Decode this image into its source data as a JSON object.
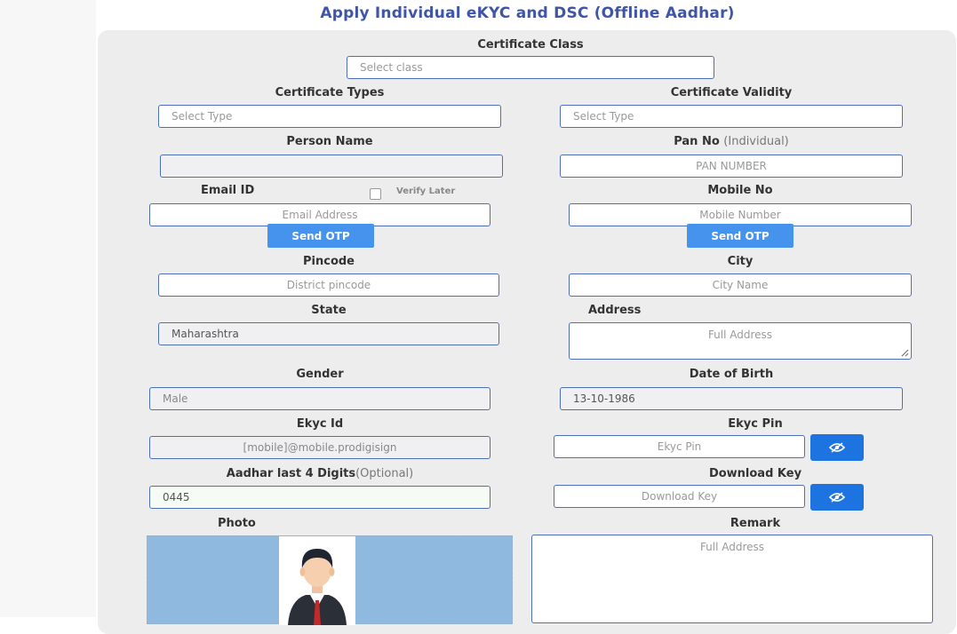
{
  "page": {
    "title": "Apply Individual eKYC and DSC (Offline Aadhar)"
  },
  "form": {
    "certificate_class": {
      "label": "Certificate Class",
      "placeholder": "Select class"
    },
    "certificate_types": {
      "label": "Certificate Types",
      "placeholder": "Select Type"
    },
    "certificate_validity": {
      "label": "Certificate Validity",
      "placeholder": "Select Type"
    },
    "person_name": {
      "label": "Person Name",
      "value": ""
    },
    "pan_no": {
      "label": "Pan No",
      "label_suffix": "(Individual)",
      "placeholder": "PAN NUMBER"
    },
    "email": {
      "label": "Email ID",
      "verify_later": "Verify Later",
      "placeholder": "Email Address",
      "send_otp": "Send OTP"
    },
    "mobile": {
      "label": "Mobile No",
      "placeholder": "Mobile Number",
      "send_otp": "Send OTP"
    },
    "pincode": {
      "label": "Pincode",
      "placeholder": "District pincode"
    },
    "city": {
      "label": "City",
      "placeholder": "City Name"
    },
    "state": {
      "label": "State",
      "value": "Maharashtra"
    },
    "address": {
      "label": "Address",
      "placeholder": "Full Address"
    },
    "gender": {
      "label": "Gender",
      "value": "Male"
    },
    "dob": {
      "label": "Date of Birth",
      "value": "13-10-1986"
    },
    "ekyc_id": {
      "label": "Ekyc Id",
      "value": "[mobile]@mobile.prodigisign"
    },
    "ekyc_pin": {
      "label": "Ekyc Pin",
      "placeholder": "Ekyc Pin"
    },
    "aadhar_last4": {
      "label": "Aadhar last 4 Digits",
      "label_suffix": "(Optional)",
      "value": "0445"
    },
    "download_key": {
      "label": "Download Key",
      "placeholder": "Download Key"
    },
    "photo": {
      "label": "Photo"
    },
    "remark": {
      "label": "Remark",
      "placeholder": "Full Address"
    }
  },
  "colors": {
    "accent": "#4593ec",
    "title": "#3f56a8",
    "border": "#4d6fb8",
    "panel": "#ededed"
  }
}
